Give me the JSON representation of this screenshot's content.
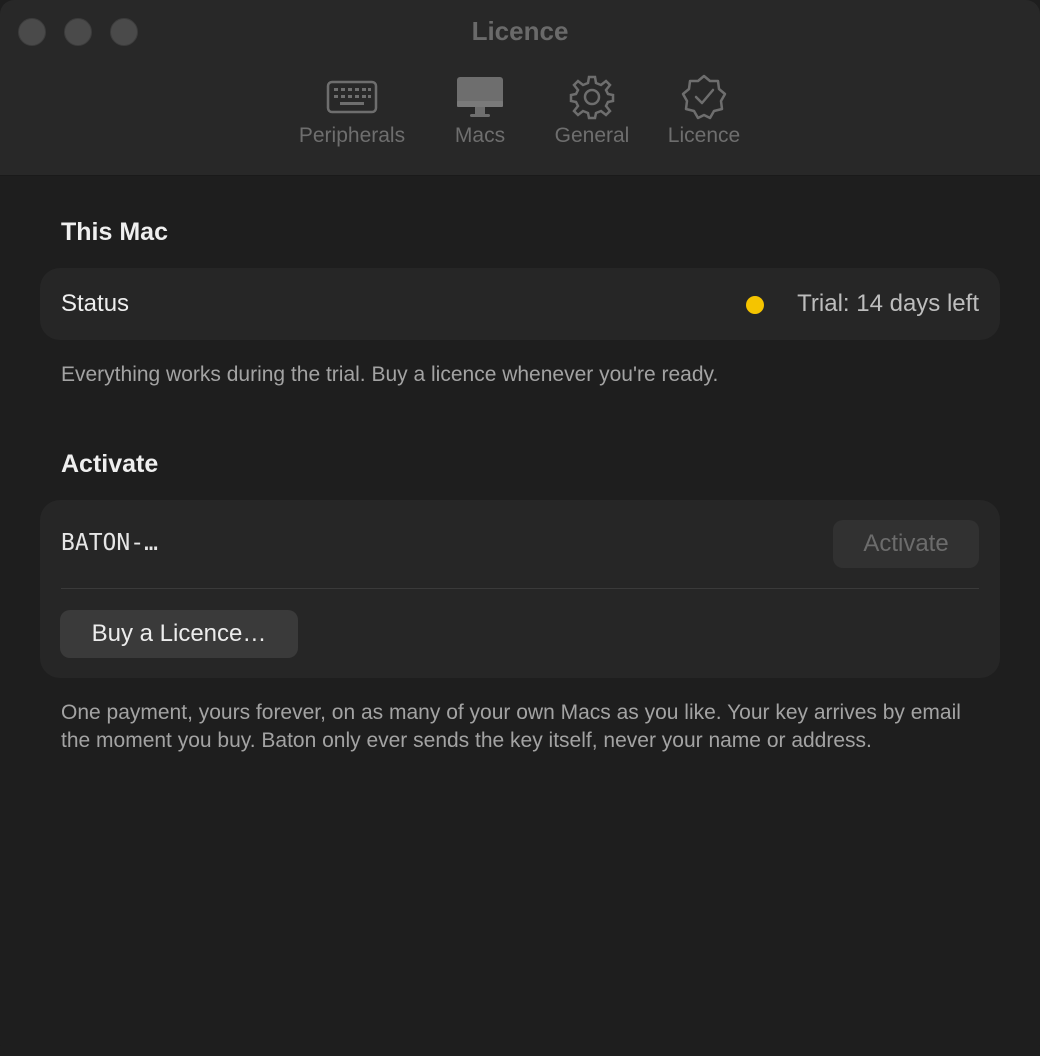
{
  "window": {
    "title": "Licence"
  },
  "toolbar": {
    "tabs": [
      {
        "label": "Peripherals",
        "icon": "keyboard-icon"
      },
      {
        "label": "Macs",
        "icon": "display-icon"
      },
      {
        "label": "General",
        "icon": "gear-icon"
      },
      {
        "label": "Licence",
        "icon": "checkmark-seal-icon"
      }
    ],
    "selected": "Licence"
  },
  "this_mac": {
    "heading": "This Mac",
    "status_label": "Status",
    "status_value": "Trial: 14 days left",
    "status_color": "#f5c400",
    "note": "Everything works during the trial. Buy a licence whenever you're ready."
  },
  "activate": {
    "heading": "Activate",
    "key_placeholder": "BATON-…",
    "activate_label": "Activate",
    "buy_label": "Buy a Licence…",
    "note": "One payment, yours forever, on as many of your own Macs as you like. Your key arrives by email the moment you buy. Baton only ever sends the key itself, never your name or address."
  }
}
